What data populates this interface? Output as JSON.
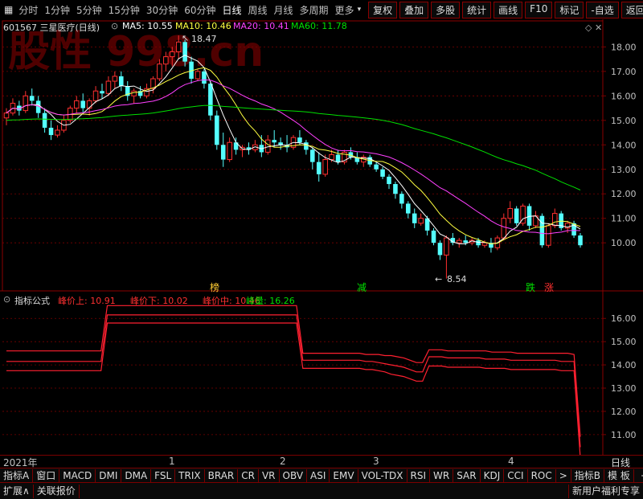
{
  "toolbar": {
    "periods": [
      "分时",
      "1分钟",
      "5分钟",
      "15分钟",
      "30分钟",
      "60分钟",
      "日线",
      "周线",
      "月线",
      "多周期",
      "更多"
    ],
    "right_buttons": [
      "复权",
      "叠加",
      "多股",
      "统计",
      "画线",
      "F10",
      "标记",
      "-自选",
      "返回"
    ]
  },
  "main_legend": {
    "title": "601567 三星医疗(日线)",
    "ma5": "MA5: 10.55",
    "ma10": "MA10: 10.46",
    "ma20": "MA20: 10.41",
    "ma60": "MA60: 11.78"
  },
  "watermark": "股性 998.cn",
  "price_axis": [
    "18.00",
    "17.00",
    "16.00",
    "15.00",
    "14.00",
    "13.00",
    "12.00",
    "11.00",
    "10.00"
  ],
  "annotations": {
    "high": "18.47",
    "low": "8.54"
  },
  "signals": [
    "榜",
    "减",
    "跌",
    "涨"
  ],
  "indicator_legend": {
    "title": "指标公式",
    "upper": "峰价上: 10.91",
    "lower": "峰价下: 10.02",
    "mid": "峰价中: 10.46",
    "volume": "峰量: 16.26"
  },
  "indicator_axis": [
    "16.00",
    "15.00",
    "14.00",
    "13.00",
    "12.00",
    "11.00"
  ],
  "x_axis": {
    "year": "2021年",
    "months": [
      "1",
      "2",
      "3",
      "4"
    ],
    "period": "日线"
  },
  "indicator_tabs": [
    "指标A",
    "窗口",
    "MACD",
    "DMI",
    "DMA",
    "FSL",
    "TRIX",
    "BRAR",
    "CR",
    "VR",
    "OBV",
    "ASI",
    "EMV",
    "VOL-TDX",
    "RSI",
    "WR",
    "SAR",
    "KDJ",
    "CCI",
    "ROC",
    ">",
    "指标B",
    "模 板"
  ],
  "tab_plus": "+",
  "tab_minus": "-",
  "status_bar": {
    "expand": "扩展∧",
    "quote": "关联报价",
    "promo": "新用户福利专享"
  },
  "colors": {
    "up": "#ff3030",
    "down": "#54ffff",
    "ma5": "#ffffff",
    "ma10": "#ffff40",
    "ma20": "#ff40ff",
    "ma60": "#00e000",
    "indicator": "#ff2030",
    "grid": "#7a0000"
  },
  "chart_data": {
    "type": "candlestick",
    "ylim": [
      8.3,
      18.8
    ],
    "candles": [
      [
        15.1,
        15.5,
        14.8,
        15.3
      ],
      [
        15.3,
        15.9,
        15.2,
        15.7
      ],
      [
        15.6,
        15.8,
        15.2,
        15.4
      ],
      [
        15.4,
        16.2,
        15.3,
        16.0
      ],
      [
        16.0,
        16.3,
        15.6,
        15.8
      ],
      [
        15.8,
        16.0,
        15.1,
        15.3
      ],
      [
        15.3,
        15.5,
        14.5,
        14.7
      ],
      [
        14.7,
        15.0,
        14.2,
        14.4
      ],
      [
        14.4,
        14.8,
        14.3,
        14.6
      ],
      [
        14.6,
        15.2,
        14.5,
        15.0
      ],
      [
        15.0,
        15.6,
        14.9,
        15.5
      ],
      [
        15.5,
        16.0,
        15.3,
        15.8
      ],
      [
        15.8,
        16.1,
        15.3,
        15.5
      ],
      [
        15.5,
        15.9,
        15.2,
        15.8
      ],
      [
        15.8,
        16.4,
        15.7,
        16.2
      ],
      [
        16.2,
        16.5,
        15.9,
        16.1
      ],
      [
        16.1,
        16.8,
        16.0,
        16.6
      ],
      [
        16.6,
        17.0,
        16.3,
        16.8
      ],
      [
        16.8,
        17.0,
        16.2,
        16.4
      ],
      [
        16.4,
        16.6,
        15.8,
        16.0
      ],
      [
        16.0,
        16.3,
        15.7,
        16.2
      ],
      [
        16.2,
        16.4,
        15.9,
        16.0
      ],
      [
        16.0,
        16.5,
        15.9,
        16.3
      ],
      [
        16.3,
        16.8,
        16.1,
        16.7
      ],
      [
        16.7,
        17.5,
        16.6,
        17.3
      ],
      [
        17.3,
        17.8,
        17.0,
        17.6
      ],
      [
        17.6,
        18.0,
        17.2,
        17.8
      ],
      [
        17.8,
        18.47,
        17.5,
        18.2
      ],
      [
        18.2,
        18.3,
        17.2,
        17.4
      ],
      [
        17.4,
        17.6,
        16.5,
        16.7
      ],
      [
        16.7,
        17.1,
        16.6,
        17.0
      ],
      [
        17.0,
        17.1,
        16.3,
        16.5
      ],
      [
        16.5,
        16.6,
        15.0,
        15.2
      ],
      [
        15.2,
        15.4,
        13.8,
        14.0
      ],
      [
        14.0,
        14.5,
        13.1,
        13.4
      ],
      [
        13.4,
        14.3,
        13.3,
        14.1
      ],
      [
        14.1,
        14.3,
        13.6,
        13.8
      ],
      [
        13.8,
        14.0,
        13.5,
        13.9
      ],
      [
        13.9,
        14.1,
        13.6,
        13.8
      ],
      [
        13.8,
        14.2,
        13.7,
        14.0
      ],
      [
        14.0,
        14.4,
        13.5,
        13.7
      ],
      [
        13.7,
        14.4,
        13.6,
        14.2
      ],
      [
        14.2,
        14.6,
        13.9,
        14.1
      ],
      [
        14.1,
        14.3,
        13.8,
        14.0
      ],
      [
        14.0,
        14.4,
        13.7,
        13.9
      ],
      [
        13.9,
        14.4,
        13.8,
        14.3
      ],
      [
        14.3,
        14.6,
        14.0,
        14.1
      ],
      [
        14.1,
        14.2,
        13.6,
        13.8
      ],
      [
        13.8,
        13.9,
        13.0,
        13.3
      ],
      [
        13.3,
        13.7,
        12.5,
        12.8
      ],
      [
        12.8,
        13.6,
        12.7,
        13.4
      ],
      [
        13.4,
        13.8,
        13.3,
        13.6
      ],
      [
        13.6,
        13.8,
        13.2,
        13.3
      ],
      [
        13.3,
        13.8,
        13.2,
        13.7
      ],
      [
        13.7,
        13.9,
        13.4,
        13.5
      ],
      [
        13.5,
        13.7,
        13.2,
        13.3
      ],
      [
        13.3,
        13.6,
        13.1,
        13.5
      ],
      [
        13.5,
        13.6,
        13.1,
        13.2
      ],
      [
        13.2,
        13.3,
        12.9,
        13.0
      ],
      [
        13.0,
        13.1,
        12.6,
        12.7
      ],
      [
        12.7,
        12.8,
        12.2,
        12.4
      ],
      [
        12.4,
        12.5,
        11.8,
        12.0
      ],
      [
        12.0,
        12.1,
        11.4,
        11.6
      ],
      [
        11.6,
        11.7,
        11.0,
        11.2
      ],
      [
        11.2,
        11.4,
        10.6,
        10.8
      ],
      [
        10.8,
        11.2,
        10.7,
        11.0
      ],
      [
        11.0,
        11.1,
        10.3,
        10.5
      ],
      [
        10.5,
        10.6,
        9.9,
        10.0
      ],
      [
        10.0,
        10.1,
        9.3,
        9.5
      ],
      [
        9.5,
        10.3,
        8.54,
        10.2
      ],
      [
        10.2,
        10.4,
        9.9,
        10.0
      ],
      [
        10.0,
        10.2,
        9.8,
        10.1
      ],
      [
        10.1,
        10.3,
        9.9,
        10.0
      ],
      [
        10.0,
        10.2,
        9.9,
        10.1
      ],
      [
        10.1,
        10.2,
        9.8,
        9.9
      ],
      [
        9.9,
        10.1,
        9.8,
        10.0
      ],
      [
        10.0,
        10.2,
        9.6,
        9.8
      ],
      [
        9.8,
        10.3,
        9.7,
        10.2
      ],
      [
        10.2,
        11.2,
        10.1,
        11.0
      ],
      [
        11.0,
        11.7,
        10.8,
        11.4
      ],
      [
        11.4,
        11.5,
        10.7,
        10.8
      ],
      [
        10.8,
        11.6,
        10.7,
        11.5
      ],
      [
        11.5,
        11.6,
        10.5,
        10.7
      ],
      [
        10.7,
        11.3,
        10.6,
        11.1
      ],
      [
        11.1,
        11.2,
        9.8,
        9.9
      ],
      [
        9.9,
        10.8,
        9.8,
        10.7
      ],
      [
        10.7,
        11.4,
        10.6,
        11.2
      ],
      [
        11.2,
        11.3,
        10.5,
        10.6
      ],
      [
        10.6,
        10.9,
        10.4,
        10.8
      ],
      [
        10.8,
        10.9,
        10.2,
        10.3
      ],
      [
        10.3,
        10.4,
        9.8,
        9.9
      ]
    ],
    "indicator": {
      "ylim": [
        10.2,
        16.7
      ],
      "upper_segments": [
        [
          14.55,
          16.55,
          14.55,
          14.3,
          14.55,
          10.91
        ]
      ],
      "series_upper": [
        14.6,
        14.6,
        14.6,
        14.6,
        14.6,
        14.6,
        14.6,
        14.6,
        14.6,
        14.6,
        14.6,
        14.6,
        14.6,
        14.6,
        14.6,
        14.6,
        16.55,
        16.55,
        16.55,
        16.55,
        16.55,
        16.55,
        16.55,
        16.55,
        16.55,
        16.55,
        16.55,
        16.55,
        16.55,
        16.55,
        16.55,
        16.55,
        16.55,
        16.55,
        16.55,
        16.55,
        16.55,
        16.55,
        16.55,
        16.55,
        16.55,
        16.55,
        16.55,
        16.55,
        16.55,
        16.55,
        16.55,
        14.5,
        14.5,
        14.5,
        14.5,
        14.5,
        14.5,
        14.5,
        14.5,
        14.5,
        14.5,
        14.45,
        14.45,
        14.45,
        14.4,
        14.4,
        14.35,
        14.3,
        14.2,
        14.1,
        14.1,
        14.65,
        14.65,
        14.65,
        14.6,
        14.6,
        14.6,
        14.6,
        14.6,
        14.6,
        14.6,
        14.55,
        14.55,
        14.55,
        14.55,
        14.5,
        14.5,
        14.5,
        14.5,
        14.5,
        14.5,
        14.5,
        14.5,
        14.5,
        14.45,
        10.91
      ],
      "series_mid": [
        14.15,
        14.15,
        14.15,
        14.15,
        14.15,
        14.15,
        14.15,
        14.15,
        14.15,
        14.15,
        14.15,
        14.15,
        14.15,
        14.15,
        14.15,
        14.15,
        16.15,
        16.15,
        16.15,
        16.15,
        16.15,
        16.15,
        16.15,
        16.15,
        16.15,
        16.15,
        16.15,
        16.15,
        16.15,
        16.15,
        16.15,
        16.15,
        16.15,
        16.15,
        16.15,
        16.15,
        16.15,
        16.15,
        16.15,
        16.15,
        16.15,
        16.15,
        16.15,
        16.15,
        16.15,
        16.15,
        16.15,
        14.2,
        14.2,
        14.2,
        14.2,
        14.2,
        14.2,
        14.2,
        14.2,
        14.2,
        14.2,
        14.15,
        14.15,
        14.1,
        14.05,
        14.0,
        13.95,
        13.9,
        13.8,
        13.7,
        13.7,
        14.35,
        14.35,
        14.35,
        14.3,
        14.3,
        14.3,
        14.3,
        14.3,
        14.3,
        14.25,
        14.25,
        14.25,
        14.25,
        14.2,
        14.2,
        14.2,
        14.2,
        14.2,
        14.2,
        14.2,
        14.2,
        14.15,
        14.15,
        14.15,
        10.46
      ],
      "series_lower": [
        13.75,
        13.75,
        13.75,
        13.75,
        13.75,
        13.75,
        13.75,
        13.75,
        13.75,
        13.75,
        13.75,
        13.75,
        13.75,
        13.75,
        13.75,
        13.75,
        15.8,
        15.8,
        15.8,
        15.8,
        15.8,
        15.8,
        15.8,
        15.8,
        15.8,
        15.8,
        15.8,
        15.8,
        15.8,
        15.8,
        15.8,
        15.8,
        15.8,
        15.8,
        15.8,
        15.8,
        15.8,
        15.8,
        15.8,
        15.8,
        15.8,
        15.8,
        15.8,
        15.8,
        15.8,
        15.8,
        15.8,
        13.85,
        13.85,
        13.85,
        13.85,
        13.85,
        13.85,
        13.85,
        13.85,
        13.85,
        13.85,
        13.8,
        13.8,
        13.75,
        13.7,
        13.6,
        13.55,
        13.5,
        13.4,
        13.3,
        13.3,
        13.95,
        13.95,
        13.95,
        13.9,
        13.9,
        13.9,
        13.9,
        13.9,
        13.9,
        13.85,
        13.85,
        13.85,
        13.85,
        13.8,
        13.8,
        13.8,
        13.8,
        13.8,
        13.8,
        13.8,
        13.8,
        13.75,
        13.75,
        13.75,
        10.02
      ]
    }
  }
}
